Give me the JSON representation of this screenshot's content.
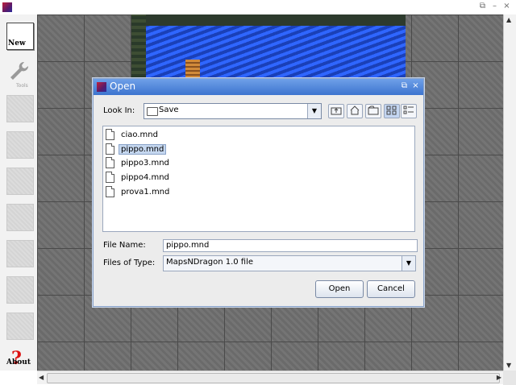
{
  "window": {
    "controls": [
      "⧉",
      "–",
      "×"
    ]
  },
  "toolbar": {
    "new_label": "New",
    "tools_label": "Tools",
    "about_label": "About",
    "about_glyph": "?",
    "items": [
      "new-icon",
      "tools-icon",
      "tile-icon",
      "tile-icon",
      "tile-icon",
      "tile-icon",
      "tile-icon",
      "tile-icon",
      "tile-icon",
      "about-icon"
    ]
  },
  "dialog": {
    "title": "Open",
    "controls": [
      "⧉",
      "×"
    ],
    "look_in_label": "Look In:",
    "look_in_value": "Save",
    "nav_buttons": [
      "up-folder-icon",
      "home-icon",
      "new-folder-icon",
      "list-view-icon",
      "details-view-icon"
    ],
    "files": [
      {
        "name": "ciao.mnd",
        "selected": false
      },
      {
        "name": "pippo.mnd",
        "selected": true
      },
      {
        "name": "pippo3.mnd",
        "selected": false
      },
      {
        "name": "pippo4.mnd",
        "selected": false
      },
      {
        "name": "prova1.mnd",
        "selected": false
      }
    ],
    "file_name_label": "File Name:",
    "file_name_value": "pippo.mnd",
    "files_of_type_label": "Files of Type:",
    "files_of_type_value": "MapsNDragon 1.0 file",
    "open_button": "Open",
    "cancel_button": "Cancel"
  },
  "colors": {
    "dialog_title_bar": "#3c74cf",
    "water": "#1e4fd8",
    "selection": "#c5d7ef"
  }
}
